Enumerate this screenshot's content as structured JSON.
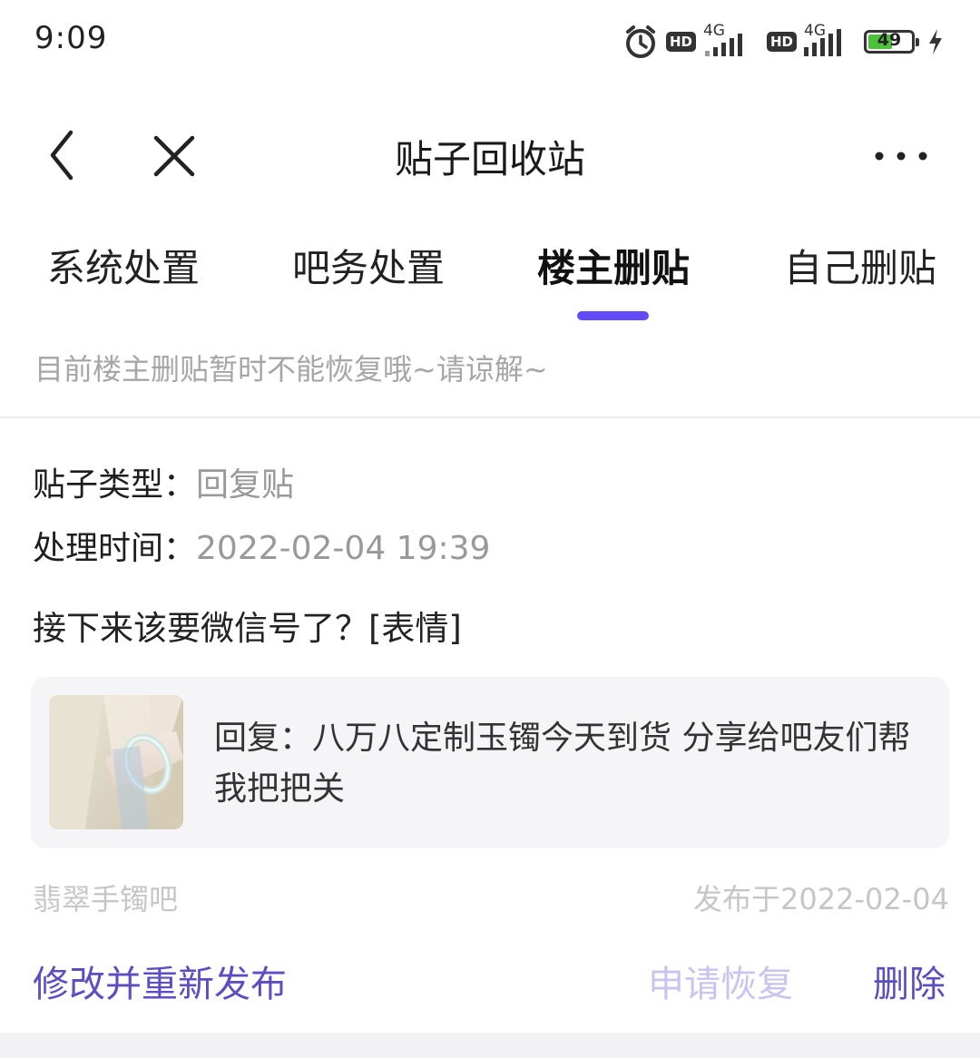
{
  "status_bar": {
    "time": "9:09",
    "network_1": "4G",
    "network_2": "4G",
    "hd_label_1": "HD",
    "hd_label_2": "HD",
    "battery": "49",
    "icons": [
      "alarm-icon",
      "signal-icon",
      "battery-icon",
      "charging-bolt-icon"
    ]
  },
  "nav": {
    "title": "贴子回收站",
    "icons": [
      "back-chevron-icon",
      "close-icon",
      "more-dots-icon"
    ]
  },
  "tabs": [
    {
      "label": "系统处置",
      "active": false
    },
    {
      "label": "吧务处置",
      "active": false
    },
    {
      "label": "楼主删贴",
      "active": true
    },
    {
      "label": "自己删贴",
      "active": false
    }
  ],
  "notice": "目前楼主删贴暂时不能恢复哦~请谅解~",
  "post": {
    "type_label": "贴子类型：",
    "type_value": "回复贴",
    "time_label": "处理时间：",
    "time_value": "2022-02-04 19:39",
    "content": "接下来该要微信号了？[表情]",
    "quote": "回复：八万八定制玉镯今天到货 分享给吧友们帮我把把关",
    "forum": "翡翠手镯吧",
    "published": "发布于2022-02-04"
  },
  "actions": {
    "edit_republish": "修改并重新发布",
    "request_restore": "申请恢复",
    "delete": "删除"
  },
  "colors": {
    "accent": "#614bf7",
    "action_primary": "#5b4ec2",
    "action_disabled": "#c9c4ef",
    "muted_text": "#a6a6a6",
    "card_bg": "#f5f5f7"
  }
}
